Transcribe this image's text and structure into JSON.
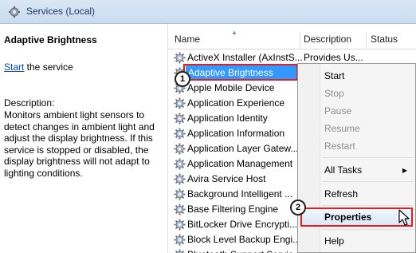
{
  "window": {
    "title": "Services (Local)",
    "icon": "services-gear-icon"
  },
  "left_pane": {
    "service_name": "Adaptive Brightness",
    "start_link": "Start",
    "start_suffix": " the service",
    "description_label": "Description:",
    "description_text": "Monitors ambient light sensors to detect changes in ambient light and adjust the display brightness.  If this service is stopped or disabled, the display brightness will not adapt to lighting conditions."
  },
  "columns": {
    "name": "Name",
    "description": "Description",
    "status": "Status"
  },
  "services": [
    {
      "name": "ActiveX Installer (AxInstS...",
      "description": "Provides Us..."
    },
    {
      "name": "Adaptive Brightness",
      "description": ""
    },
    {
      "name": "Apple Mobile Device",
      "description": ""
    },
    {
      "name": "Application Experience",
      "description": ""
    },
    {
      "name": "Application Identity",
      "description": ""
    },
    {
      "name": "Application Information",
      "description": ""
    },
    {
      "name": "Application Layer Gatew...",
      "description": ""
    },
    {
      "name": "Application Management",
      "description": ""
    },
    {
      "name": "Avira Service Host",
      "description": ""
    },
    {
      "name": "Background Intelligent ...",
      "description": ""
    },
    {
      "name": "Base Filtering Engine",
      "description": ""
    },
    {
      "name": "BitLocker Drive Encrypti...",
      "description": ""
    },
    {
      "name": "Block Level Backup Engi...",
      "description": ""
    },
    {
      "name": "Bluetooth Support Servic...",
      "description": ""
    }
  ],
  "context_menu": {
    "start": "Start",
    "stop": "Stop",
    "pause": "Pause",
    "resume": "Resume",
    "restart": "Restart",
    "all_tasks": "All Tasks",
    "refresh": "Refresh",
    "properties": "Properties",
    "help": "Help"
  },
  "callouts": {
    "one": "1",
    "two": "2"
  },
  "colors": {
    "selection": "#3399ff",
    "highlight_outline": "#e02020",
    "link": "#0645ad"
  }
}
